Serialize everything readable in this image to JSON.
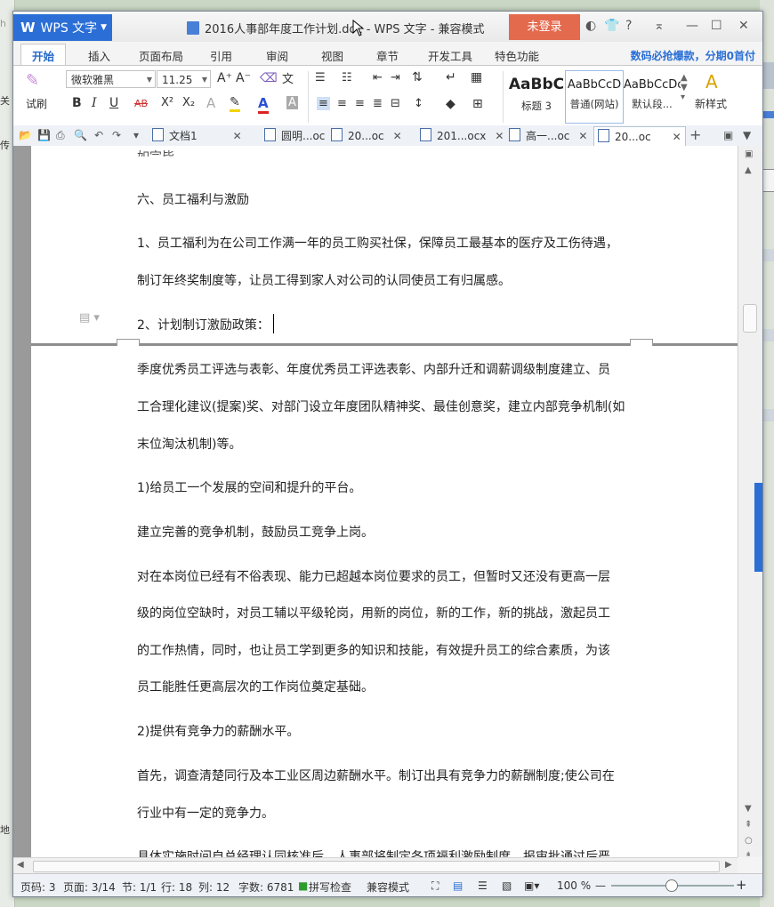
{
  "window": {
    "app_name": "WPS 文字",
    "app_logo": "W",
    "title": "2016人事部年度工作计划.doc - WPS 文字 - 兼容模式",
    "login_button": "未登录"
  },
  "titlebar_icons": [
    "skin-icon",
    "shirt-icon",
    "help-icon",
    "collapse-ribbon-icon",
    "minimize-icon",
    "maximize-icon",
    "close-icon"
  ],
  "titlebar_glyphs": {
    "help": "?",
    "minimize": "—",
    "maximize": "☐",
    "close": "✕"
  },
  "ribbon_tabs": [
    {
      "label": "开始",
      "active": true
    },
    {
      "label": "插入"
    },
    {
      "label": "页面布局"
    },
    {
      "label": "引用"
    },
    {
      "label": "审阅"
    },
    {
      "label": "视图"
    },
    {
      "label": "章节"
    },
    {
      "label": "开发工具"
    },
    {
      "label": "特色功能"
    }
  ],
  "promo_text": "数码必抢爆款，分期0首付",
  "ribbon": {
    "format_brush": "试刷",
    "font_name": "微软雅黑",
    "font_size": "11.25",
    "bold": "B",
    "italic": "I",
    "underline": "U",
    "strike": "AB",
    "superscript": "X²",
    "subscript": "X₂",
    "grow_font": "A⁺",
    "shrink_font": "A⁻",
    "styles": [
      {
        "sample": "AaBbC",
        "label": "标题 3"
      },
      {
        "sample": "AaBbCcD",
        "label": "普通(网站)"
      },
      {
        "sample": "AaBbCcDc",
        "label": "默认段..."
      }
    ],
    "new_style": "新样式"
  },
  "doc_tabs": [
    {
      "label": "文档1"
    },
    {
      "label": "圆明...oc"
    },
    {
      "label": "20...oc"
    },
    {
      "label": "201...ocx"
    },
    {
      "label": "高一...oc"
    },
    {
      "label": "20...oc",
      "active": true
    }
  ],
  "page1_lines": [
    "六、员工福利与激励",
    "1、员工福利为在公司工作满一年的员工购买社保，保障员工最基本的医疗及工伤待遇，",
    "制订年终奖制度等，让员工得到家人对公司的认同使员工有归属感。",
    "2、计划制订激励政策："
  ],
  "page2_lines": [
    "季度优秀员工评选与表彰、年度优秀员工评选表彰、内部升迁和调薪调级制度建立、员",
    "工合理化建议(提案)奖、对部门设立年度团队精神奖、最佳创意奖，建立内部竞争机制(如",
    "末位淘汰机制)等。",
    "1)给员工一个发展的空间和提升的平台。",
    "建立完善的竞争机制，鼓励员工竞争上岗。",
    "对在本岗位已经有不俗表现、能力已超越本岗位要求的员工，但暂时又还没有更高一层",
    "级的岗位空缺时，对员工辅以平级轮岗，用新的岗位，新的工作，新的挑战，激起员工",
    "的工作热情，同时，也让员工学到更多的知识和技能，有效提升员工的综合素质，为该",
    "员工能胜任更高层次的工作岗位奠定基础。",
    "2)提供有竞争力的薪酬水平。",
    "首先，调查清楚同行及本工业区周边薪酬水平。制订出具有竞争力的薪酬制度;使公司在",
    "行业中有一定的竞争力。",
    "具体实施时间自总经理认同核准后，人事部将制定各项福利激励制度，报审批通过后严"
  ],
  "status": {
    "page_code": "页码: 3",
    "pages": "页面: 3/14",
    "section": "节: 1/1",
    "row": "行: 18",
    "col": "列: 12",
    "words": "字数: 6781",
    "spell": "拼写检查",
    "compat": "兼容模式",
    "zoom": "100 %",
    "zoom_level": 1.0
  },
  "colors": {
    "brand": "#2b6fd6",
    "login": "#e46a4e",
    "active_tab": "#2468c9"
  }
}
